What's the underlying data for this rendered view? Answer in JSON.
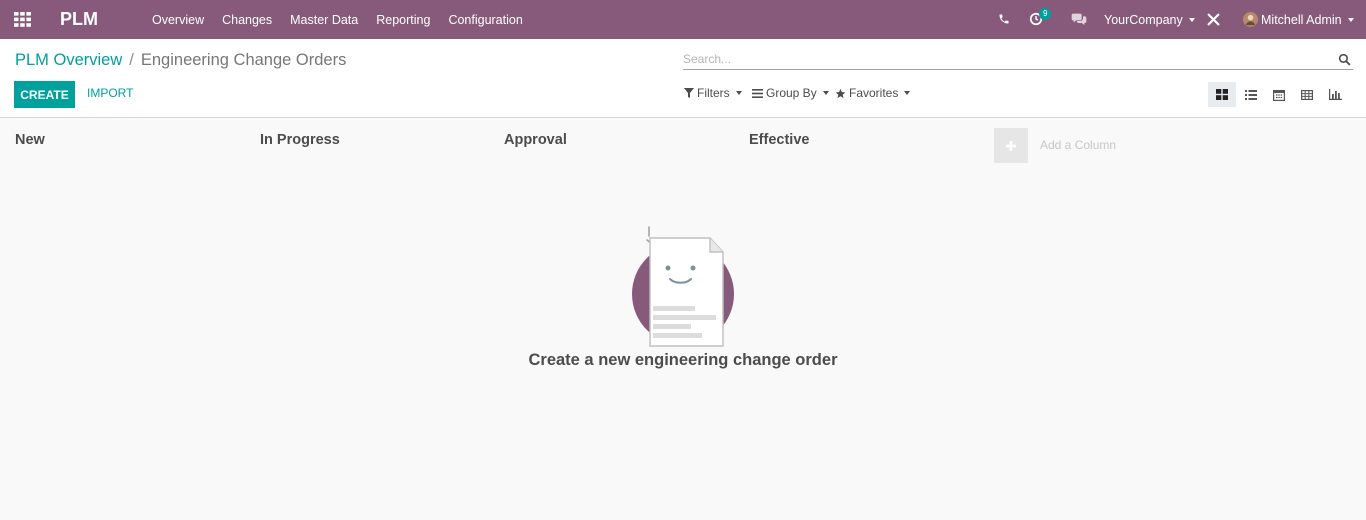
{
  "navbar": {
    "app_name": "PLM",
    "menu": [
      "Overview",
      "Changes",
      "Master Data",
      "Reporting",
      "Configuration"
    ],
    "activity_count": "9",
    "company": "YourCompany",
    "user": "Mitchell Admin"
  },
  "control_panel": {
    "breadcrumb": {
      "parent": "PLM Overview",
      "separator": "/",
      "current": "Engineering Change Orders"
    },
    "create_label": "CREATE",
    "import_label": "IMPORT",
    "search_placeholder": "Search...",
    "filters_label": "Filters",
    "group_by_label": "Group By",
    "favorites_label": "Favorites"
  },
  "kanban": {
    "columns": [
      "New",
      "In Progress",
      "Approval",
      "Effective"
    ],
    "add_column_label": "Add a Column",
    "help_text": "Create a new engineering change order"
  },
  "colors": {
    "brand": "#875a7b",
    "accent": "#00a09d"
  }
}
